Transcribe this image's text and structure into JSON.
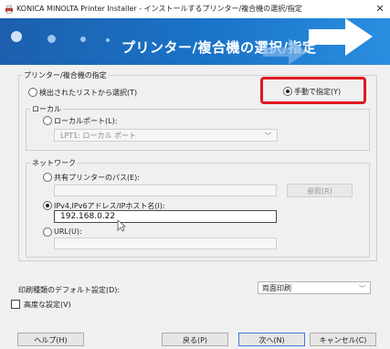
{
  "window": {
    "title": "KONICA MINOLTA Printer Installer - インストールするプリンター/複合機の選択/指定",
    "close_glyph": "✕"
  },
  "banner": {
    "title": "プリンター/複合機の選択/指定"
  },
  "printer_group": {
    "label": "プリンター/複合機の指定",
    "radio_detected": "検出されたリストから選択(T)",
    "radio_manual": "手動で指定(Y)",
    "selected": "manual"
  },
  "local_group": {
    "label": "ローカル",
    "radio_local_port": "ローカルポート(L):",
    "port_value": "LPT1:  ローカル ポート"
  },
  "network_group": {
    "label": "ネットワーク",
    "radio_share": "共有プリンターのパス(E):",
    "browse_button": "参照(R)",
    "radio_ip": "IPv4,IPv6アドレス/IPホスト名(I):",
    "ip_value": "192.168.0.22",
    "radio_url": "URL(U):",
    "selected": "ip"
  },
  "default_print": {
    "label": "印刷種類のデフォルト設定(D):",
    "value": "両面印刷"
  },
  "advanced": {
    "label": "高度な設定(V)",
    "checked": false
  },
  "footer": {
    "help": "ヘルプ(H)",
    "back": "戻る(P)",
    "next": "次へ(N)",
    "cancel": "キャンセル(C)"
  },
  "colors": {
    "banner": "#1a74c8",
    "highlight": "#e0191e"
  }
}
